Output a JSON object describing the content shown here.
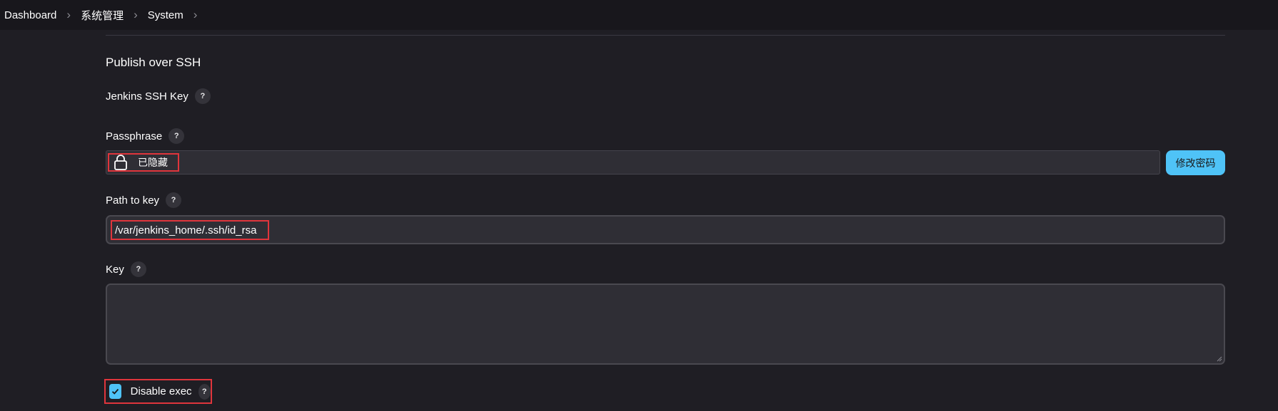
{
  "breadcrumb": {
    "items": [
      "Dashboard",
      "系统管理",
      "System"
    ]
  },
  "section": {
    "title": "Publish over SSH"
  },
  "fields": {
    "ssh_key_label": "Jenkins SSH Key",
    "passphrase": {
      "label": "Passphrase",
      "hidden_text": "已隐藏",
      "change_button": "修改密码"
    },
    "path_to_key": {
      "label": "Path to key",
      "value": "/var/jenkins_home/.ssh/id_rsa"
    },
    "key": {
      "label": "Key",
      "value": ""
    },
    "disable_exec": {
      "label": "Disable exec",
      "checked": true
    }
  },
  "help_glyph": "?",
  "colors": {
    "background": "#1f1e24",
    "topbar": "#18171c",
    "accent": "#4fc3f7",
    "highlight": "#e0353c",
    "input_bg": "#2f2e35"
  }
}
